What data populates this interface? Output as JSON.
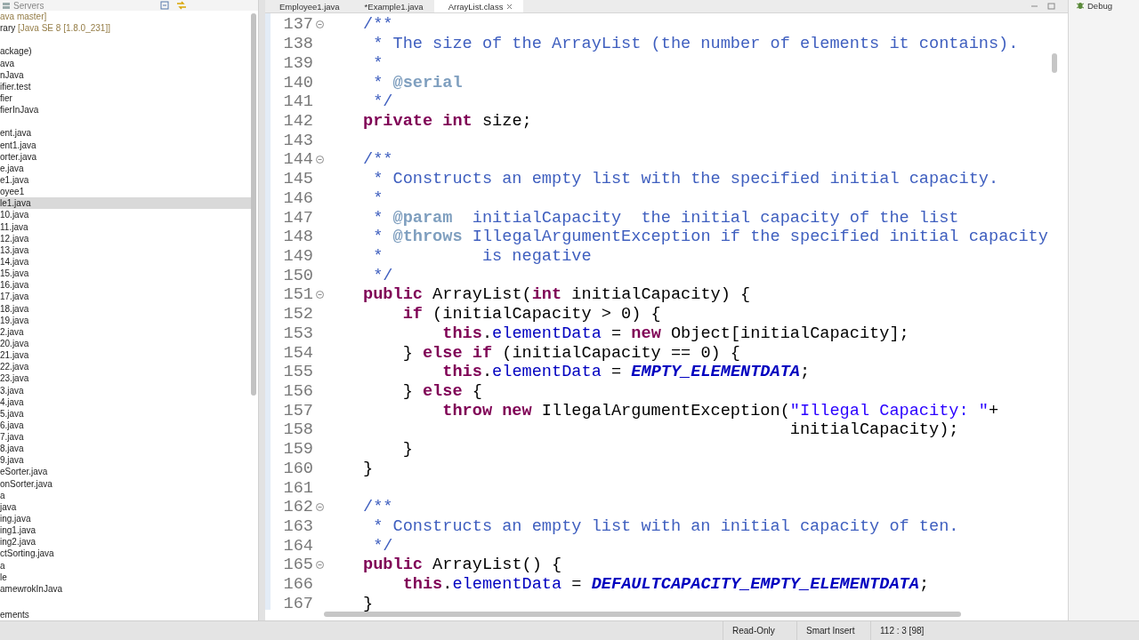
{
  "explorer": {
    "tab": "Servers",
    "items": [
      {
        "detail": "ava master]",
        "selected": false
      },
      {
        "label": "rary ",
        "detail": "[Java SE 8 [1.8.0_231]]",
        "selected": false
      },
      {
        "label": "ackage)",
        "selected": false,
        "gap_before": true
      },
      {
        "label": "ava",
        "selected": false
      },
      {
        "label": "nJava",
        "selected": false
      },
      {
        "label": "ifier.test",
        "selected": false
      },
      {
        "label": "fier",
        "selected": false
      },
      {
        "label": "fierInJava",
        "selected": false
      },
      {
        "label": "ent.java",
        "selected": false,
        "gap_before": true
      },
      {
        "label": "ent1.java",
        "selected": false
      },
      {
        "label": "orter.java",
        "selected": false
      },
      {
        "label": "e.java",
        "selected": false
      },
      {
        "label": "e1.java",
        "selected": false
      },
      {
        "label": "oyee1",
        "selected": false
      },
      {
        "label": "le1.java",
        "selected": true
      },
      {
        "label": "10.java",
        "selected": false
      },
      {
        "label": "11.java",
        "selected": false
      },
      {
        "label": "12.java",
        "selected": false
      },
      {
        "label": "13.java",
        "selected": false
      },
      {
        "label": "14.java",
        "selected": false
      },
      {
        "label": "15.java",
        "selected": false
      },
      {
        "label": "16.java",
        "selected": false
      },
      {
        "label": "17.java",
        "selected": false
      },
      {
        "label": "18.java",
        "selected": false
      },
      {
        "label": "19.java",
        "selected": false
      },
      {
        "label": "2.java",
        "selected": false
      },
      {
        "label": "20.java",
        "selected": false
      },
      {
        "label": "21.java",
        "selected": false
      },
      {
        "label": "22.java",
        "selected": false
      },
      {
        "label": "23.java",
        "selected": false
      },
      {
        "label": "3.java",
        "selected": false
      },
      {
        "label": "4.java",
        "selected": false
      },
      {
        "label": "5.java",
        "selected": false
      },
      {
        "label": "6.java",
        "selected": false
      },
      {
        "label": "7.java",
        "selected": false
      },
      {
        "label": "8.java",
        "selected": false
      },
      {
        "label": "9.java",
        "selected": false
      },
      {
        "label": "eSorter.java",
        "selected": false
      },
      {
        "label": "onSorter.java",
        "selected": false
      },
      {
        "label": "a",
        "selected": false
      },
      {
        "label": "java",
        "selected": false
      },
      {
        "label": "ing.java",
        "selected": false
      },
      {
        "label": "ing1.java",
        "selected": false
      },
      {
        "label": "ing2.java",
        "selected": false
      },
      {
        "label": "ctSorting.java",
        "selected": false
      },
      {
        "label": "a",
        "selected": false
      },
      {
        "label": "le",
        "selected": false
      },
      {
        "label": "amewrokInJava",
        "selected": false
      },
      {
        "label": "ements",
        "selected": false
      }
    ]
  },
  "editor": {
    "tabs": [
      {
        "label": "Employee1.java",
        "selected": false
      },
      {
        "label": "*Example1.java",
        "selected": false
      },
      {
        "label": "ArrayList.class",
        "selected": true
      }
    ],
    "lines": [
      {
        "number": "137",
        "foldable": true,
        "tokens": [
          {
            "kind": "comment",
            "text": "/**"
          }
        ]
      },
      {
        "number": "138",
        "foldable": false,
        "tokens": [
          {
            "kind": "comment",
            "text": " * The size of the ArrayList (the number of elements it contains)."
          }
        ]
      },
      {
        "number": "139",
        "foldable": false,
        "tokens": [
          {
            "kind": "comment",
            "text": " *"
          }
        ]
      },
      {
        "number": "140",
        "foldable": false,
        "tokens": [
          {
            "kind": "comment",
            "text": " * "
          },
          {
            "kind": "tag",
            "text": "@serial"
          }
        ]
      },
      {
        "number": "141",
        "foldable": false,
        "tokens": [
          {
            "kind": "comment",
            "text": " */"
          }
        ]
      },
      {
        "number": "142",
        "foldable": false,
        "tokens": [
          {
            "kind": "keyword",
            "text": "private int"
          },
          {
            "kind": "plain",
            "text": " size;"
          }
        ]
      },
      {
        "number": "143",
        "foldable": false
      },
      {
        "number": "144",
        "foldable": true,
        "tokens": [
          {
            "kind": "comment",
            "text": "/**"
          }
        ]
      },
      {
        "number": "145",
        "foldable": false,
        "tokens": [
          {
            "kind": "comment",
            "text": " * Constructs an empty list with the specified initial capacity."
          }
        ]
      },
      {
        "number": "146",
        "foldable": false,
        "tokens": [
          {
            "kind": "comment",
            "text": " *"
          }
        ]
      },
      {
        "number": "147",
        "foldable": false,
        "tokens": [
          {
            "kind": "comment",
            "text": " * "
          },
          {
            "kind": "tag",
            "text": "@param"
          },
          {
            "kind": "comment",
            "text": "  initialCapacity  the initial capacity of the list"
          }
        ]
      },
      {
        "number": "148",
        "foldable": false,
        "tokens": [
          {
            "kind": "comment",
            "text": " * "
          },
          {
            "kind": "tag",
            "text": "@throws"
          },
          {
            "kind": "comment",
            "text": " IllegalArgumentException if the specified initial capacity"
          }
        ]
      },
      {
        "number": "149",
        "foldable": false,
        "tokens": [
          {
            "kind": "comment",
            "text": " *          is negative"
          }
        ]
      },
      {
        "number": "150",
        "foldable": false,
        "tokens": [
          {
            "kind": "comment",
            "text": " */"
          }
        ]
      },
      {
        "number": "151",
        "foldable": true,
        "tokens": [
          {
            "kind": "keyword",
            "text": "public"
          },
          {
            "kind": "plain",
            "text": " ArrayList("
          },
          {
            "kind": "keyword",
            "text": "int"
          },
          {
            "kind": "plain",
            "text": " initialCapacity) {"
          }
        ]
      },
      {
        "number": "152",
        "foldable": false,
        "tokens": [
          {
            "kind": "keyword",
            "text": "    if"
          },
          {
            "kind": "plain",
            "text": " (initialCapacity > 0) {"
          }
        ]
      },
      {
        "number": "153",
        "foldable": false,
        "tokens": [
          {
            "kind": "keyword",
            "text": "        this"
          },
          {
            "kind": "plain",
            "text": "."
          },
          {
            "kind": "field",
            "text": "elementData"
          },
          {
            "kind": "plain",
            "text": " = "
          },
          {
            "kind": "keyword",
            "text": "new"
          },
          {
            "kind": "plain",
            "text": " Object[initialCapacity];"
          }
        ]
      },
      {
        "number": "154",
        "foldable": false,
        "tokens": [
          {
            "kind": "plain",
            "text": "    } "
          },
          {
            "kind": "keyword",
            "text": "else if"
          },
          {
            "kind": "plain",
            "text": " (initialCapacity == 0) {"
          }
        ]
      },
      {
        "number": "155",
        "foldable": false,
        "tokens": [
          {
            "kind": "keyword",
            "text": "        this"
          },
          {
            "kind": "plain",
            "text": "."
          },
          {
            "kind": "field",
            "text": "elementData"
          },
          {
            "kind": "plain",
            "text": " = "
          },
          {
            "kind": "constant",
            "text": "EMPTY_ELEMENTDATA"
          },
          {
            "kind": "plain",
            "text": ";"
          }
        ]
      },
      {
        "number": "156",
        "foldable": false,
        "tokens": [
          {
            "kind": "plain",
            "text": "    } "
          },
          {
            "kind": "keyword",
            "text": "else"
          },
          {
            "kind": "plain",
            "text": " {"
          }
        ]
      },
      {
        "number": "157",
        "foldable": false,
        "tokens": [
          {
            "kind": "keyword",
            "text": "        throw new"
          },
          {
            "kind": "plain",
            "text": " IllegalArgumentException("
          },
          {
            "kind": "string",
            "text": "\"Illegal Capacity: \""
          },
          {
            "kind": "plain",
            "text": "+"
          }
        ]
      },
      {
        "number": "158",
        "foldable": false,
        "tokens": [
          {
            "kind": "plain",
            "text": "                                           initialCapacity);"
          }
        ]
      },
      {
        "number": "159",
        "foldable": false,
        "tokens": [
          {
            "kind": "plain",
            "text": "    }"
          }
        ]
      },
      {
        "number": "160",
        "foldable": false,
        "tokens": [
          {
            "kind": "plain",
            "text": "}"
          }
        ]
      },
      {
        "number": "161",
        "foldable": false
      },
      {
        "number": "162",
        "foldable": true,
        "tokens": [
          {
            "kind": "comment",
            "text": "/**"
          }
        ]
      },
      {
        "number": "163",
        "foldable": false,
        "tokens": [
          {
            "kind": "comment",
            "text": " * Constructs an empty list with an initial capacity of ten."
          }
        ]
      },
      {
        "number": "164",
        "foldable": false,
        "tokens": [
          {
            "kind": "comment",
            "text": " */"
          }
        ]
      },
      {
        "number": "165",
        "foldable": true,
        "tokens": [
          {
            "kind": "keyword",
            "text": "public"
          },
          {
            "kind": "plain",
            "text": " ArrayList() {"
          }
        ]
      },
      {
        "number": "166",
        "foldable": false,
        "tokens": [
          {
            "kind": "keyword",
            "text": "    this"
          },
          {
            "kind": "plain",
            "text": "."
          },
          {
            "kind": "field",
            "text": "elementData"
          },
          {
            "kind": "plain",
            "text": " = "
          },
          {
            "kind": "constant",
            "text": "DEFAULTCAPACITY_EMPTY_ELEMENTDATA"
          },
          {
            "kind": "plain",
            "text": ";"
          }
        ]
      },
      {
        "number": "167",
        "foldable": false,
        "tokens": [
          {
            "kind": "plain",
            "text": "}"
          }
        ]
      }
    ]
  },
  "perspective": {
    "label": "Debug"
  },
  "status_bar": {
    "items": [
      "Read-Only",
      "Smart Insert",
      "112 : 3 [98]"
    ]
  }
}
